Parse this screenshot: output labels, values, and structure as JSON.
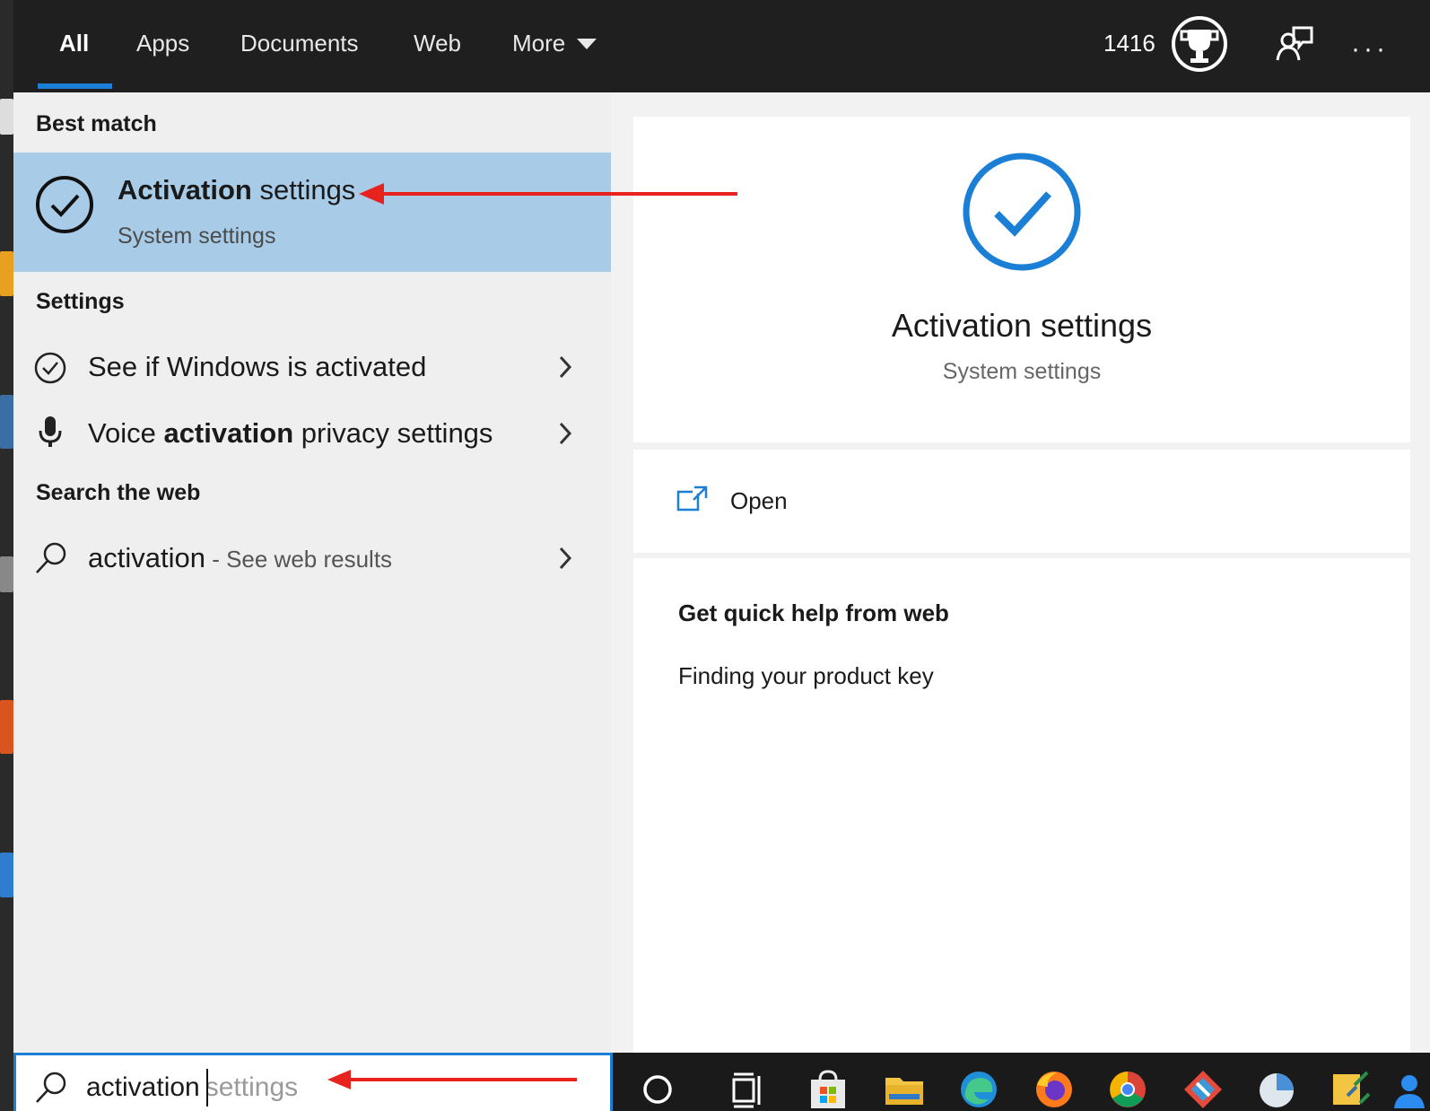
{
  "tabs": [
    "All",
    "Apps",
    "Documents",
    "Web",
    "More"
  ],
  "header": {
    "points": "1416"
  },
  "left": {
    "best_match_heading": "Best match",
    "best_match": {
      "title_bold": "Activation",
      "title_rest": " settings",
      "subtitle": "System settings"
    },
    "settings_heading": "Settings",
    "settings_items": [
      {
        "pre": "See if Windows is activated",
        "bold": "",
        "post": ""
      },
      {
        "pre": "Voice ",
        "bold": "activation",
        "post": " privacy settings"
      }
    ],
    "web_heading": "Search the web",
    "web_item": {
      "query": "activation",
      "suffix": " - See web results"
    }
  },
  "preview": {
    "title": "Activation settings",
    "subtitle": "System settings",
    "open_label": "Open",
    "help_heading": "Get quick help from web",
    "help_link": "Finding your product key"
  },
  "search": {
    "typed": "activation",
    "suggestion": "settings"
  },
  "icons": {
    "trophy": "trophy-icon",
    "feedback": "feedback-icon",
    "more": "ellipsis-icon",
    "check": "checkmark-circle-icon",
    "mic": "microphone-icon",
    "search": "search-icon",
    "open": "open-external-icon",
    "chevron": "chevron-right-icon"
  },
  "colors": {
    "accent": "#1b7fd6",
    "selected_row": "#a8cce8",
    "annotation_arrow": "#e8231d"
  }
}
